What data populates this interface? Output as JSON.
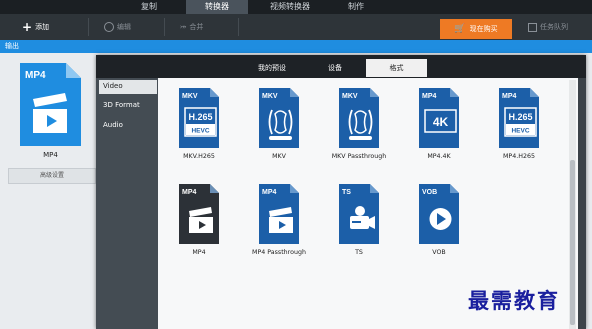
{
  "top_tabs": [
    {
      "label": "复制",
      "active": false
    },
    {
      "label": "转换器",
      "active": true
    },
    {
      "label": "视频转换器",
      "active": false
    },
    {
      "label": "制作",
      "active": false
    }
  ],
  "toolbar": {
    "add_label": "添加",
    "edit_label": "编辑",
    "merge_label": "合并",
    "buy_label": "现在购买",
    "queue_label": "任务队列"
  },
  "output_label": "输出",
  "current_format": {
    "tag": "MP4",
    "label": "MP4"
  },
  "advanced_settings_label": "高级设置",
  "dialog_tabs": [
    {
      "label": "我的预设",
      "active": false
    },
    {
      "label": "设备",
      "active": false
    },
    {
      "label": "格式",
      "active": true
    }
  ],
  "sidebar_items": [
    {
      "label": "Video",
      "active": true
    },
    {
      "label": "3D Format",
      "active": false
    },
    {
      "label": "Audio",
      "active": false
    }
  ],
  "formats": [
    {
      "tag": "MKV",
      "badge": "H.265",
      "sub": "HEVC",
      "label": "MKV.H265",
      "kind": "hevc",
      "dark": false
    },
    {
      "tag": "MKV",
      "badge": "",
      "sub": "",
      "label": "MKV",
      "kind": "doll",
      "dark": false
    },
    {
      "tag": "MKV",
      "badge": "",
      "sub": "",
      "label": "MKV Passthrough",
      "kind": "doll",
      "dark": false
    },
    {
      "tag": "MP4",
      "badge": "4K",
      "sub": "",
      "label": "MP4.4K",
      "kind": "4k",
      "dark": false
    },
    {
      "tag": "MP4",
      "badge": "H.265",
      "sub": "HEVC",
      "label": "MP4.H265",
      "kind": "hevc",
      "dark": false
    },
    {
      "tag": "MP4",
      "badge": "",
      "sub": "",
      "label": "MP4",
      "kind": "clap",
      "dark": true
    },
    {
      "tag": "MP4",
      "badge": "",
      "sub": "",
      "label": "MP4 Passthrough",
      "kind": "clap",
      "dark": false
    },
    {
      "tag": "TS",
      "badge": "",
      "sub": "",
      "label": "TS",
      "kind": "cam",
      "dark": false
    },
    {
      "tag": "VOB",
      "badge": "",
      "sub": "",
      "label": "VOB",
      "kind": "play",
      "dark": false
    }
  ],
  "colors": {
    "accent": "#1f8de0",
    "buy": "#ee7a24",
    "icon_blue": "#1c5fa8",
    "icon_dark": "#2c3137"
  },
  "watermark": "最需教育"
}
